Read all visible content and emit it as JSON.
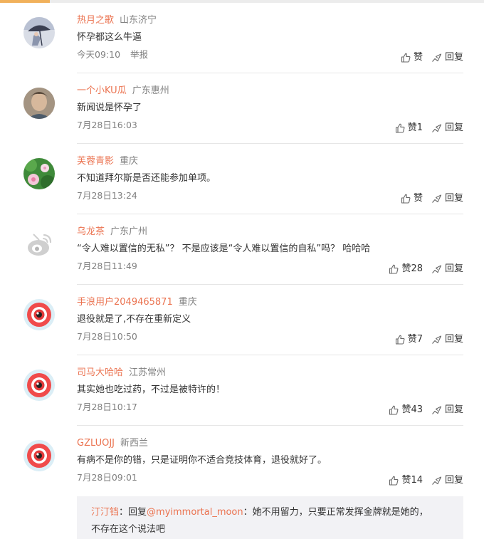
{
  "comments": [
    {
      "username": "热月之歌",
      "location": "山东济宁",
      "text": "怀孕都这么牛逼",
      "time": "今天09:10",
      "report": "举报",
      "like_label": "赞",
      "reply_label": "回复",
      "avatar_icon": "umbrella-avatar-icon"
    },
    {
      "username": "一个小KU瓜",
      "location": "广东惠州",
      "text": "新闻说是怀孕了",
      "time": "7月28日16:03",
      "like_label": "赞1",
      "reply_label": "回复",
      "avatar_icon": "portrait-avatar-icon"
    },
    {
      "username": "芙蓉青影",
      "location": "重庆",
      "text": "不知道拜尔斯是否还能参加单项。",
      "time": "7月28日13:24",
      "like_label": "赞",
      "reply_label": "回复",
      "avatar_icon": "flower-avatar-icon"
    },
    {
      "username": "乌龙茶",
      "location": "广东广州",
      "text": "“令人难以置信的无私”？  不是应该是“令人难以置信的自私”吗？  哈哈哈",
      "time": "7月28日11:49",
      "like_label": "赞28",
      "reply_label": "回复",
      "avatar_icon": "weibo-grey-avatar-icon"
    },
    {
      "username": "手浪用户2049465871",
      "location": "重庆",
      "text": "退役就是了,不存在重新定义",
      "time": "7月28日10:50",
      "like_label": "赞7",
      "reply_label": "回复",
      "avatar_icon": "weibo-red-avatar-icon"
    },
    {
      "username": "司马大哈哈",
      "location": "江苏常州",
      "text": "其实她也吃过药，不过是被特许的！",
      "time": "7月28日10:17",
      "like_label": "赞43",
      "reply_label": "回复",
      "avatar_icon": "weibo-red-avatar-icon"
    },
    {
      "username": "GZLUOJJ",
      "location": "新西兰",
      "text": "有病不是你的错，只是证明你不适合竞技体育，退役就好了。",
      "time": "7月28日09:01",
      "like_label": "赞14",
      "reply_label": "回复",
      "avatar_icon": "weibo-red-avatar-icon"
    }
  ],
  "reply": {
    "user": "汀汀铛",
    "separator": "：",
    "reply_word": "回复",
    "mention": "@myimmortal_moon",
    "mention_sep": "：",
    "text": "她不用留力，只要正常发挥金牌就是她的，",
    "text_line2": "不存在这个说法吧"
  },
  "colors": {
    "username": "#eb7350",
    "meta": "#808080",
    "text": "#333333",
    "divider": "#e6e6e6",
    "reply_bg": "#f2f2f5"
  }
}
